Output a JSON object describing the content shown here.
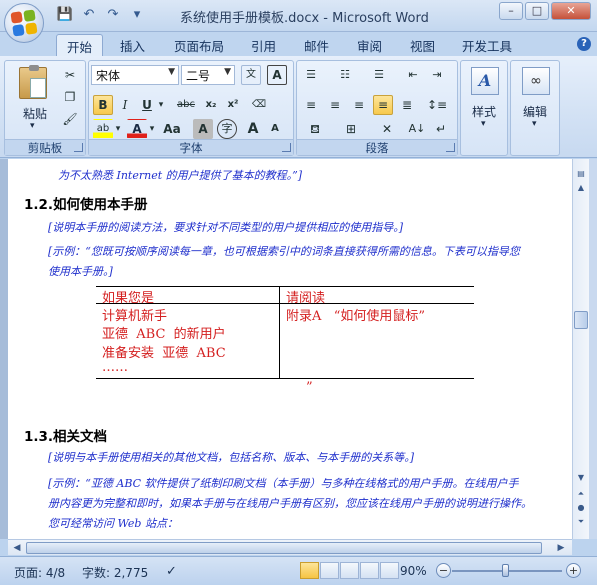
{
  "window": {
    "title": "系统使用手册模板.docx - Microsoft Word",
    "minimize": "–",
    "maximize": "□",
    "close": "✕"
  },
  "quick_access": {
    "icons": [
      "save-icon",
      "undo-icon",
      "redo-icon",
      "customize-icon"
    ]
  },
  "tabs": [
    {
      "label": "开始",
      "active": true
    },
    {
      "label": "插入"
    },
    {
      "label": "页面布局"
    },
    {
      "label": "引用"
    },
    {
      "label": "邮件"
    },
    {
      "label": "审阅"
    },
    {
      "label": "视图"
    },
    {
      "label": "开发工具"
    }
  ],
  "ribbon": {
    "clipboard": {
      "paste_label": "粘贴",
      "group_label": "剪贴板"
    },
    "font": {
      "font_name": "宋体",
      "font_size": "二号",
      "group_label": "字体",
      "bold": "B",
      "italic": "I",
      "underline": "U",
      "strike": "abc",
      "subscript": "x₂",
      "superscript": "x²",
      "aa": "Aa",
      "grow": "A",
      "shrink": "A",
      "wen": "文",
      "char_border": "A"
    },
    "paragraph": {
      "group_label": "段落"
    },
    "styles": {
      "label": "样式"
    },
    "editing": {
      "label": "编辑"
    }
  },
  "document": {
    "line_top": "为不太熟悉 Internet 的用户提供了基本的教程。”]",
    "h12": "1.2.如何使用本手册",
    "h12_hint": "[说明本手册的阅读方法，要求针对不同类型的用户提供相应的使用指导。]",
    "h12_example_1": "[示例：“您既可按顺序阅读每一章，也可根据索引中的词条直接获得所需的信息。下表可以指导您",
    "h12_example_2": "使用本手册。]",
    "table": {
      "headers": [
        "如果您是",
        "请阅读"
      ],
      "col1_lines": [
        "计算机新手",
        "亚德  ABC  的新用户",
        "准备安装  亚德  ABC",
        "……"
      ],
      "col2": "附录A   “如何使用鼠标”",
      "after": "”"
    },
    "h13": "1.3.相关文档",
    "h13_hint": "[说明与本手册使用相关的其他文档，包括名称、版本、与本手册的关系等。]",
    "h13_example_1": "[示例：“亚德 ABC 软件提供了纸制印刷文档（本手册）与多种在线格式的用户手册。在线用户手",
    "h13_example_2": "册内容更为完整和即时，如果本手册与在线用户手册有区别，您应该在线用户手册的说明进行操作。",
    "h13_example_3": "您可经常访问 Web 站点："
  },
  "status": {
    "page": "页面: 4/8",
    "words": "字数: 2,775",
    "zoom": "90%",
    "zoom_level_percent": 90
  }
}
